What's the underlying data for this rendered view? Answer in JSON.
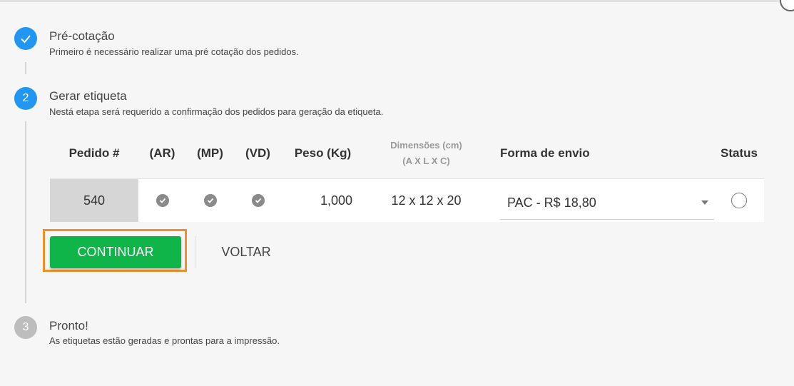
{
  "steps": [
    {
      "number": "✓",
      "title": "Pré-cotação",
      "description": "Primeiro é necessário realizar uma pré cotação dos pedidos.",
      "state": "done"
    },
    {
      "number": "2",
      "title": "Gerar etiqueta",
      "description": "Nestá etapa será requerido a confirmação dos pedidos para geração da etiqueta.",
      "state": "active"
    },
    {
      "number": "3",
      "title": "Pronto!",
      "description": "As etiquetas estão geradas e prontas para a impressão.",
      "state": "pending"
    }
  ],
  "table": {
    "headers": {
      "pedido": "Pedido #",
      "ar": "(AR)",
      "mp": "(MP)",
      "vd": "(VD)",
      "peso": "Peso (Kg)",
      "dimensoes": "Dimensões (cm)",
      "dimensoes_sub": "(A X L X C)",
      "forma": "Forma de envio",
      "status": "Status"
    },
    "rows": [
      {
        "pedido": "540",
        "ar": true,
        "mp": true,
        "vd": true,
        "peso": "1,000",
        "dimensoes": "12 x 12 x 20",
        "forma_envio": "PAC - R$ 18,80",
        "status": false
      }
    ]
  },
  "buttons": {
    "continuar": "CONTINUAR",
    "voltar": "VOLTAR"
  },
  "colors": {
    "primary": "#2196f3",
    "success": "#10b54a",
    "highlight": "#f0902a",
    "pending": "#bdbdbd"
  }
}
